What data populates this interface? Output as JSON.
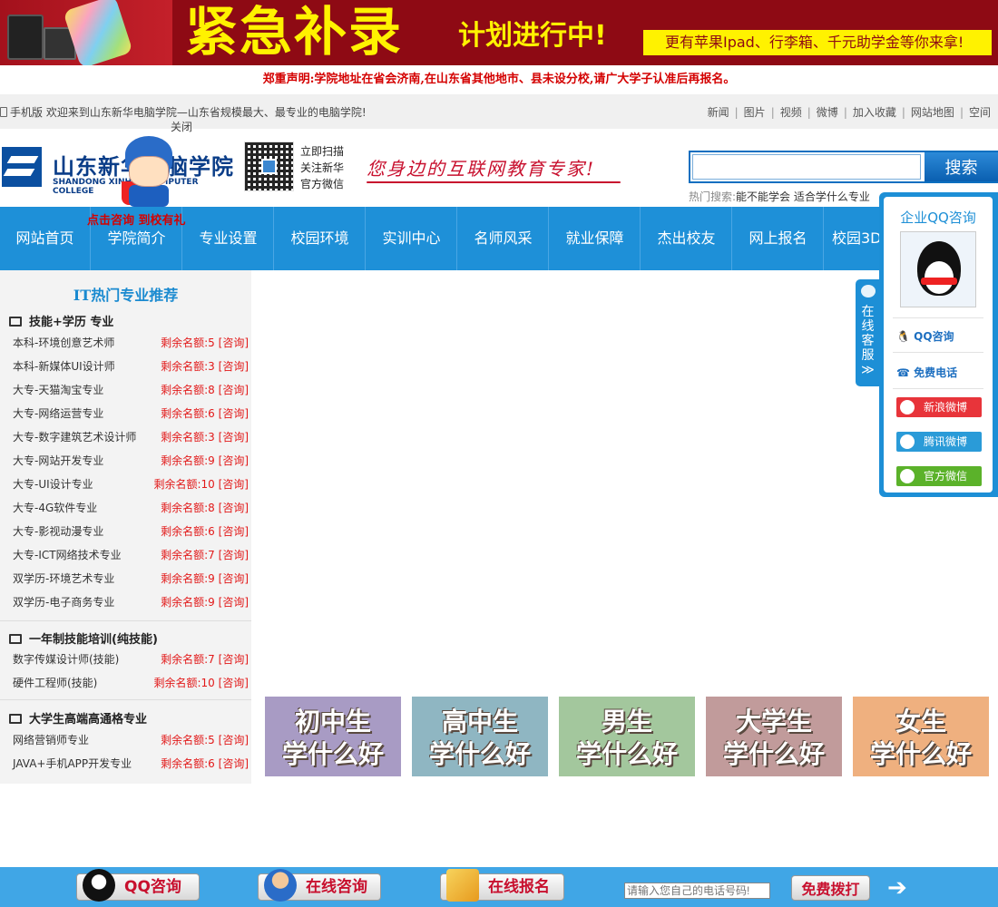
{
  "banner": {
    "title": "紧急补录",
    "subtitle": "计划进行中!",
    "promo": "更有苹果Ipad、行李箱、千元助学金等你来拿!"
  },
  "notice": "郑重声明:学院地址在省会济南,在山东省其他地市、县未设分校,请广大学子认准后再报名。",
  "topbar": {
    "welcome": "手机版 欢迎来到山东新华电脑学院—山东省规模最大、最专业的电脑学院!",
    "close": "关闭",
    "links": [
      "新闻",
      "图片",
      "视频",
      "微博",
      "加入收藏",
      "网站地图",
      "空间"
    ]
  },
  "header": {
    "logo_cn": "山东新华电脑学院",
    "logo_en": "SHANDONG XINHUA COMPUTER COLLEGE",
    "qr_lines": [
      "立即扫描",
      "关注新华",
      "官方微信"
    ],
    "slogan": "您身边的互联网教育专家!",
    "search_button": "搜索",
    "search_value": "",
    "hot_label": "热门搜索:",
    "hot_keywords": "能不能学会 适合学什么专业"
  },
  "nav": {
    "items": [
      "网站首页",
      "学院简介",
      "专业设置",
      "校园环境",
      "实训中心",
      "名师风采",
      "就业保障",
      "杰出校友",
      "网上报名",
      "校园3D"
    ],
    "promo": "点击咨询 到校有礼"
  },
  "sidebar": {
    "heading": "IT热门专业推荐",
    "sections": [
      {
        "title": "技能+学历 专业",
        "rows": [
          {
            "name": "本科-环境创意艺术师",
            "remain": "剩余名额:5 [咨询]"
          },
          {
            "name": "本科-新媒体UI设计师",
            "remain": "剩余名额:3 [咨询]"
          },
          {
            "name": "大专-天猫淘宝专业",
            "remain": "剩余名额:8 [咨询]"
          },
          {
            "name": "大专-网络运营专业",
            "remain": "剩余名额:6 [咨询]"
          },
          {
            "name": "大专-数字建筑艺术设计师",
            "remain": "剩余名额:3 [咨询]"
          },
          {
            "name": "大专-网站开发专业",
            "remain": "剩余名额:9 [咨询]"
          },
          {
            "name": "大专-UI设计专业",
            "remain": "剩余名额:10 [咨询]"
          },
          {
            "name": "大专-4G软件专业",
            "remain": "剩余名额:8 [咨询]"
          },
          {
            "name": "大专-影视动漫专业",
            "remain": "剩余名额:6 [咨询]"
          },
          {
            "name": "大专-ICT网络技术专业",
            "remain": "剩余名额:7 [咨询]"
          },
          {
            "name": "双学历-环境艺术专业",
            "remain": "剩余名额:9 [咨询]"
          },
          {
            "name": "双学历-电子商务专业",
            "remain": "剩余名额:9 [咨询]"
          }
        ]
      },
      {
        "title": "一年制技能培训(纯技能)",
        "rows": [
          {
            "name": "数字传媒设计师(技能)",
            "remain": "剩余名额:7 [咨询]"
          },
          {
            "name": "硬件工程师(技能)",
            "remain": "剩余名额:10 [咨询]"
          }
        ]
      },
      {
        "title": "大学生高端高通格专业",
        "rows": [
          {
            "name": "网络营销师专业",
            "remain": "剩余名额:5 [咨询]"
          },
          {
            "name": "JAVA+手机APP开发专业",
            "remain": "剩余名额:6 [咨询]"
          }
        ]
      }
    ]
  },
  "tiles": [
    {
      "line1": "初中生",
      "line2": "学什么好",
      "color": "#a89bc4"
    },
    {
      "line1": "高中生",
      "line2": "学什么好",
      "color": "#8fb6c2"
    },
    {
      "line1": "男生",
      "line2": "学什么好",
      "color": "#a3c79d"
    },
    {
      "line1": "大学生",
      "line2": "学什么好",
      "color": "#c19b9b"
    },
    {
      "line1": "女生",
      "line2": "学什么好",
      "color": "#efb07f"
    }
  ],
  "qq_panel": {
    "title": "企业QQ咨询",
    "qq_link": "QQ咨询",
    "phone_link": "免费电话",
    "buttons": [
      {
        "label": "新浪微博",
        "color": "#e8343a"
      },
      {
        "label": "腾讯微博",
        "color": "#2a9bd8"
      },
      {
        "label": "官方微信",
        "color": "#5bb22a"
      }
    ],
    "tab_label": "在线客服",
    "tab_arrow": "≫"
  },
  "footer": {
    "buttons": [
      "QQ咨询",
      "在线咨询",
      "在线报名"
    ],
    "phone_placeholder": "请输入您自己的电话号码!",
    "call_button": "免费拨打",
    "arrow": "➔"
  },
  "colors": {
    "banner_red": "#8e0a14",
    "banner_yellow": "#fff200",
    "nav_blue": "#1e90d8",
    "footer_blue": "#40a6e6",
    "alert_red": "#e21a1a"
  }
}
